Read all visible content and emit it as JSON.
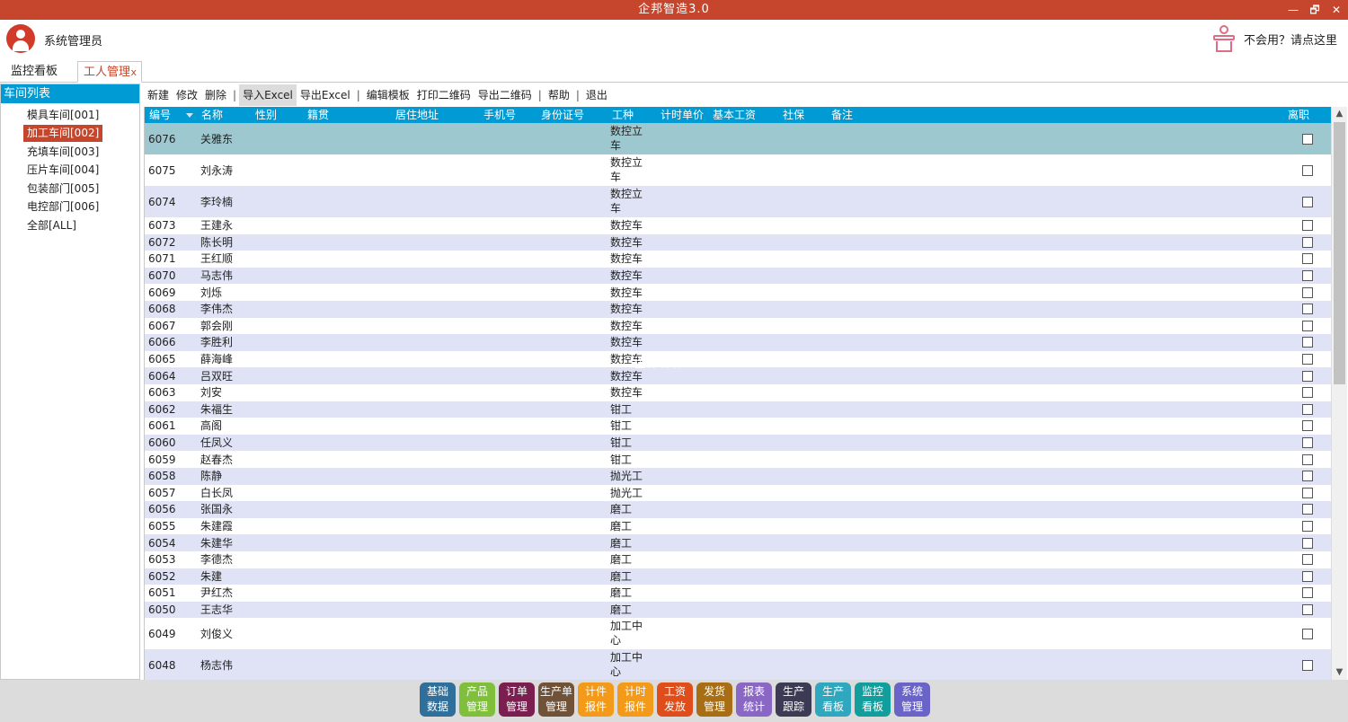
{
  "app": {
    "title": "企邦智造3.0",
    "watermark": "企邦计件3.0"
  },
  "window": {
    "minimize": "—",
    "restore": "🗗",
    "close": "✕"
  },
  "header": {
    "username": "系统管理员",
    "help_text": "不会用？请点这里"
  },
  "tabs": [
    {
      "label": "监控看板"
    },
    {
      "label": "工人管理",
      "close": "x",
      "active": true
    }
  ],
  "left": {
    "title": "车间列表",
    "items": [
      {
        "label": "模具车间[001]"
      },
      {
        "label": "加工车间[002]",
        "selected": true
      },
      {
        "label": "充填车间[003]"
      },
      {
        "label": "压片车间[004]"
      },
      {
        "label": "包装部门[005]"
      },
      {
        "label": "电控部门[006]"
      },
      {
        "label": "全部[ALL]"
      }
    ]
  },
  "toolbar": [
    {
      "label": "新建"
    },
    {
      "label": "修改"
    },
    {
      "label": "删除"
    },
    {
      "sep": "|"
    },
    {
      "label": "导入Excel",
      "highlight": true
    },
    {
      "label": "导出Excel"
    },
    {
      "sep": "|"
    },
    {
      "label": "编辑模板"
    },
    {
      "label": "打印二维码"
    },
    {
      "label": "导出二维码"
    },
    {
      "sep": "|"
    },
    {
      "label": "帮助"
    },
    {
      "sep": "|"
    },
    {
      "label": "退出"
    }
  ],
  "columns": [
    "编号",
    "名称",
    "性别",
    "籍贯",
    "居住地址",
    "手机号",
    "身份证号",
    "工种",
    "计时单价",
    "基本工资",
    "社保",
    "备注",
    "离职"
  ],
  "rows": [
    {
      "id": "6076",
      "name": "关雅东",
      "job": "数控立车",
      "left": false
    },
    {
      "id": "6075",
      "name": "刘永涛",
      "job": "数控立车",
      "left": false
    },
    {
      "id": "6074",
      "name": "李玲楠",
      "job": "数控立车",
      "left": false
    },
    {
      "id": "6073",
      "name": "王建永",
      "job": "数控车",
      "left": false
    },
    {
      "id": "6072",
      "name": "陈长明",
      "job": "数控车",
      "left": false
    },
    {
      "id": "6071",
      "name": "王红顺",
      "job": "数控车",
      "left": false
    },
    {
      "id": "6070",
      "name": "马志伟",
      "job": "数控车",
      "left": false
    },
    {
      "id": "6069",
      "name": "刘烁",
      "job": "数控车",
      "left": false
    },
    {
      "id": "6068",
      "name": "李伟杰",
      "job": "数控车",
      "left": false
    },
    {
      "id": "6067",
      "name": "郭会刚",
      "job": "数控车",
      "left": false
    },
    {
      "id": "6066",
      "name": "李胜利",
      "job": "数控车",
      "left": false
    },
    {
      "id": "6065",
      "name": "薛海峰",
      "job": "数控车",
      "left": false
    },
    {
      "id": "6064",
      "name": "吕双旺",
      "job": "数控车",
      "left": false
    },
    {
      "id": "6063",
      "name": "刘安",
      "job": "数控车",
      "left": false
    },
    {
      "id": "6062",
      "name": "朱福生",
      "job": "钳工",
      "left": false
    },
    {
      "id": "6061",
      "name": "高阁",
      "job": "钳工",
      "left": false
    },
    {
      "id": "6060",
      "name": "任凤义",
      "job": "钳工",
      "left": false
    },
    {
      "id": "6059",
      "name": "赵春杰",
      "job": "钳工",
      "left": false
    },
    {
      "id": "6058",
      "name": "陈静",
      "job": "抛光工",
      "left": false
    },
    {
      "id": "6057",
      "name": "白长凤",
      "job": "抛光工",
      "left": false
    },
    {
      "id": "6056",
      "name": "张国永",
      "job": "磨工",
      "left": false
    },
    {
      "id": "6055",
      "name": "朱建霞",
      "job": "磨工",
      "left": false
    },
    {
      "id": "6054",
      "name": "朱建华",
      "job": "磨工",
      "left": false
    },
    {
      "id": "6053",
      "name": "李德杰",
      "job": "磨工",
      "left": false
    },
    {
      "id": "6052",
      "name": "朱建",
      "job": "磨工",
      "left": false
    },
    {
      "id": "6051",
      "name": "尹红杰",
      "job": "磨工",
      "left": false
    },
    {
      "id": "6050",
      "name": "王志华",
      "job": "磨工",
      "left": false
    },
    {
      "id": "6049",
      "name": "刘俊义",
      "job": "加工中心",
      "left": false
    },
    {
      "id": "6048",
      "name": "杨志伟",
      "job": "加工中心",
      "left": false
    }
  ],
  "bottom_nav": [
    {
      "l1": "基础",
      "l2": "数据",
      "color": "#2f6f9a"
    },
    {
      "l1": "产品",
      "l2": "管理",
      "color": "#7fbf3c"
    },
    {
      "l1": "订单",
      "l2": "管理",
      "color": "#7a1f4f"
    },
    {
      "l1": "生产单",
      "l2": "管理",
      "color": "#6f5238"
    },
    {
      "l1": "计件",
      "l2": "报件",
      "color": "#f39a1a"
    },
    {
      "l1": "计时",
      "l2": "报件",
      "color": "#f39a1a"
    },
    {
      "l1": "工资",
      "l2": "发放",
      "color": "#df4d1b"
    },
    {
      "l1": "发货",
      "l2": "管理",
      "color": "#a86e16"
    },
    {
      "l1": "报表",
      "l2": "统计",
      "color": "#8a67c4"
    },
    {
      "l1": "生产",
      "l2": "跟踪",
      "color": "#3b3b55"
    },
    {
      "l1": "生产",
      "l2": "看板",
      "color": "#2fa7bf"
    },
    {
      "l1": "监控",
      "l2": "看板",
      "color": "#139e9e"
    },
    {
      "l1": "系统",
      "l2": "管理",
      "color": "#6a64c8"
    }
  ]
}
